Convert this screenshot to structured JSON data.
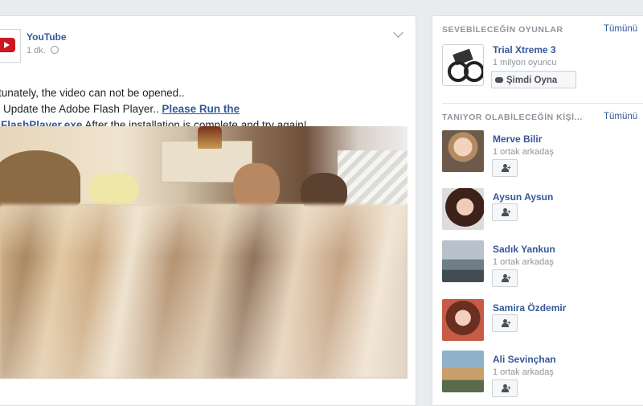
{
  "post": {
    "page_name": "YouTube",
    "time": "1 dk.",
    "line1": "ortunately, the video can not be opened..",
    "line2_text": "se Update the Adobe Flash Player.. ",
    "line2_link": "Please Run the",
    "line3_link": "allFlashPlayer.exe",
    "line3_text": " After the installation is complete and try again!.."
  },
  "games": {
    "title": "SEVEBİLECEĞİN OYUNLAR",
    "see_all": "Tümünü",
    "game_name": "Trial Xtreme 3",
    "game_players": "1 milyon oyuncu",
    "play_button": "Şimdi Oyna"
  },
  "people": {
    "title": "TANIYOR OLABİLECEĞİN KİŞİ...",
    "see_all": "Tümünü",
    "items": [
      {
        "name": "Merve Bilir",
        "mutual": "1 ortak arkadaş"
      },
      {
        "name": "Aysun Aysun",
        "mutual": ""
      },
      {
        "name": "Sadık Yankun",
        "mutual": "1 ortak arkadaş"
      },
      {
        "name": "Samira Özdemir",
        "mutual": ""
      },
      {
        "name": "Ali Sevinçhan",
        "mutual": "1 ortak arkadaş"
      }
    ]
  },
  "colors": {
    "link": "#365899",
    "background": "#e9ebee",
    "youtube_red": "#cc181e"
  },
  "icons": [
    "youtube-logo-icon",
    "globe-icon",
    "chevron-down-icon",
    "gamepad-icon",
    "add-friend-icon"
  ]
}
